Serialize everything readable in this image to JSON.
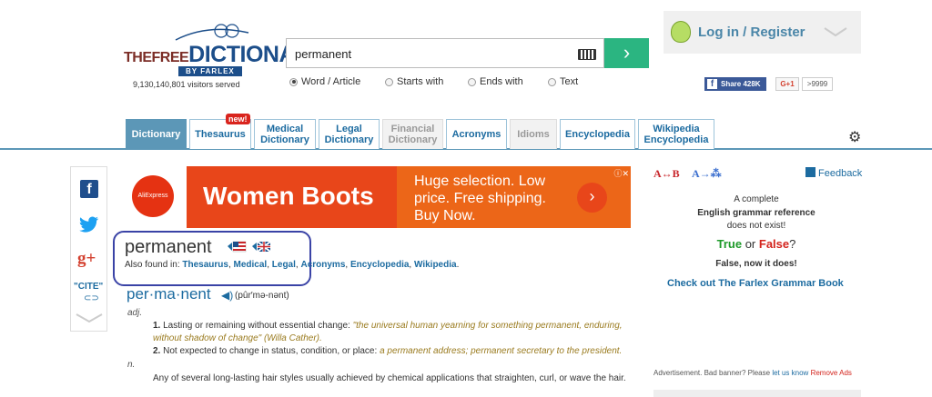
{
  "header": {
    "logo_text": "THEFREEDICTIONARY BY FARLEX",
    "visitors": "9,130,140,801 visitors served"
  },
  "search": {
    "value": "permanent",
    "go_icon": "chevron-right-icon",
    "keyboard_icon": "keyboard-icon",
    "options": [
      {
        "label": "Word / Article",
        "selected": true
      },
      {
        "label": "Starts with",
        "selected": false
      },
      {
        "label": "Ends with",
        "selected": false
      },
      {
        "label": "Text",
        "selected": false
      }
    ]
  },
  "account": {
    "login_label": "Log in / Register"
  },
  "share": {
    "facebook_label": "Share 428K",
    "gplus_label": "G+1",
    "gplus_count": ">9999"
  },
  "tabs": [
    {
      "label": "Dictionary",
      "state": "active"
    },
    {
      "label": "Thesaurus",
      "state": "normal"
    },
    {
      "label": "Medical Dictionary",
      "state": "normal"
    },
    {
      "label": "Legal Dictionary",
      "state": "normal"
    },
    {
      "label": "Financial Dictionary",
      "state": "dim"
    },
    {
      "label": "Acronyms",
      "state": "normal"
    },
    {
      "label": "Idioms",
      "state": "dim"
    },
    {
      "label": "Encyclopedia",
      "state": "normal"
    },
    {
      "label": "Wikipedia Encyclopedia",
      "state": "normal"
    }
  ],
  "new_badge": "new!",
  "social": {
    "cite_label": "\"CITE\""
  },
  "ad": {
    "brand": "AliExpress",
    "headline": "Women Boots",
    "copy": "Huge selection. Low price. Free shipping. Buy Now."
  },
  "entry": {
    "headword": "permanent",
    "also_found_prefix": "Also found in:",
    "also_found": [
      "Thesaurus",
      "Medical",
      "Legal",
      "Acronyms",
      "Encyclopedia",
      "Wikipedia"
    ],
    "syllabified": "per·ma·nent",
    "pronunciation": "(pûr′mə-nənt)",
    "pos_adj": "adj.",
    "pos_n": "n.",
    "def1_text": "Lasting or remaining without essential change:",
    "def1_example": "\"the universal human yearning for something permanent, enduring, without shadow of change\" (Willa Cather).",
    "def2_text": "Not expected to change in status, condition, or place:",
    "def2_example": "a permanent address; permanent secretary to the president.",
    "noun_def": "Any of several long-lasting hair styles usually achieved by chemical applications that straighten, curl, or wave the hair."
  },
  "sidebar": {
    "feedback_label": "Feedback",
    "promo_line1": "A complete",
    "promo_line2": "English grammar reference",
    "promo_line3": "does not exist!",
    "true_label": "True",
    "or_label": "or",
    "false_label": "False",
    "question": "?",
    "now_label": "False, now it does!",
    "grammar_link": "Check out The Farlex Grammar Book",
    "ad_notice": "Advertisement. Bad banner? Please",
    "let_us_know": "let us know",
    "remove_ads": "Remove Ads"
  }
}
